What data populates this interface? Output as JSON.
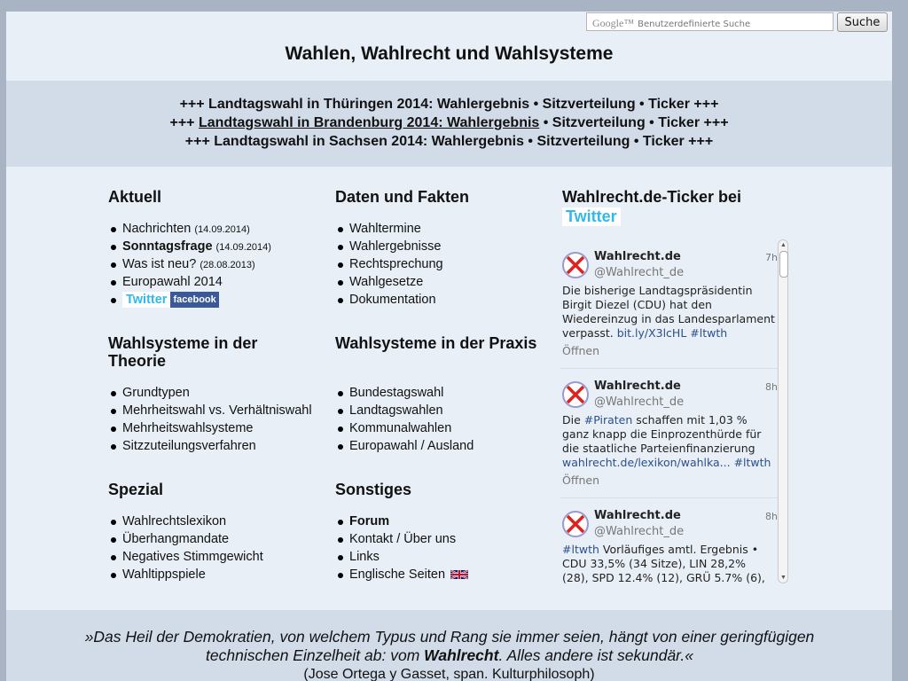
{
  "search": {
    "logo": "Google™",
    "placeholder": "Benutzerdefinierte Suche",
    "button": "Suche"
  },
  "site_title": "Wahlen, Wahlrecht und Wahlsysteme",
  "ticker_lines": [
    {
      "pre": "+++ Landtagswahl in Thüringen 2014: Wahlergebnis",
      "post": " • Sitzverteilung • Ticker +++"
    },
    {
      "pre": "+++ ",
      "link": "Landtagswahl in Brandenburg 2014: Wahlergebnis",
      "post": " • Sitzverteilung • Ticker +++"
    },
    {
      "pre": "+++ Landtagswahl in Sachsen 2014: Wahlergebnis",
      "post": " • Sitzverteilung • Ticker +++"
    }
  ],
  "aktuell": {
    "title": "Aktuell",
    "items": [
      {
        "label": "Nachrichten",
        "date": "(14.09.2014)"
      },
      {
        "label": "Sonntagsfrage",
        "date": "(14.09.2014)"
      },
      {
        "label": "Was ist neu?",
        "date": "(28.08.2013)"
      },
      {
        "label": "Europawahl 2014"
      }
    ],
    "twitter": "Twitter",
    "facebook": "facebook"
  },
  "daten": {
    "title": "Daten und Fakten",
    "items": [
      "Wahltermine",
      "Wahlergebnisse",
      "Rechtsprechung",
      "Wahlgesetze",
      "Dokumentation"
    ]
  },
  "theorie": {
    "title_line1": "Wahlsysteme in der",
    "title_line2": "Theorie",
    "items": [
      "Grundtypen",
      "Mehrheitswahl vs. Verhältniswahl",
      "Mehrheitswahlsysteme",
      "Sitzzuteilungsverfahren"
    ]
  },
  "praxis": {
    "title": "Wahlsysteme in der Praxis",
    "items": [
      "Bundestagswahl",
      "Landtagswahlen",
      "Kommunalwahlen",
      "Europawahl / Ausland"
    ]
  },
  "spezial": {
    "title": "Spezial",
    "items": [
      "Wahlrechtslexikon",
      "Überhangmandate",
      "Negatives Stimmgewicht",
      "Wahltippspiele"
    ]
  },
  "sonstiges": {
    "title": "Sonstiges",
    "items": [
      "Forum",
      "Kontakt / Über uns",
      "Links",
      "Englische Seiten"
    ]
  },
  "twitter_widget": {
    "title": "Wahlrecht.de-Ticker bei",
    "title_word": "Twitter",
    "tweets": [
      {
        "author": "Wahlrecht.de",
        "handle": "@Wahlrecht_de",
        "time": "7h",
        "lines": [
          "Die bisherige Landtagspräsidentin",
          "Birgit Diezel (CDU) hat den",
          "Wiedereinzug in das Landesparlament"
        ],
        "last_text": "verpasst. ",
        "last_link": "bit.ly/X3lcHL #ltwth",
        "open": "Öffnen"
      },
      {
        "author": "Wahlrecht.de",
        "handle": "@Wahlrecht_de",
        "time": "8h",
        "first_pre": "Die ",
        "first_link": "#Piraten",
        "first_post": " schaffen mit 1,03 %",
        "lines": [
          "ganz knapp die Einprozenthürde für",
          "die staatliche Parteienfinanzierung"
        ],
        "last_link": "wahlrecht.de/lexikon/wahlka... #ltwth",
        "open": "Öffnen"
      },
      {
        "author": "Wahlrecht.de",
        "handle": "@Wahlrecht_de",
        "time": "8h",
        "first_link": "#ltwth",
        "first_post": " Vorläufiges amtl. Ergebnis •",
        "lines": [
          "CDU 33,5% (34 Sitze), LIN 28,2%",
          "(28), SPD 12.4% (12), GRÜ 5.7% (6),"
        ]
      }
    ]
  },
  "quote": {
    "part1": "»Das Heil der Demokratien, von welchem Typus und Rang sie immer seien, hängt von einer geringfügigen technischen Einzelheit ab: vom ",
    "bold": "Wahlrecht",
    "part2": ". Alles andere ist sekundär.«",
    "source": "(Jose Ortega y Gasset, span. Kulturphilosoph)"
  }
}
